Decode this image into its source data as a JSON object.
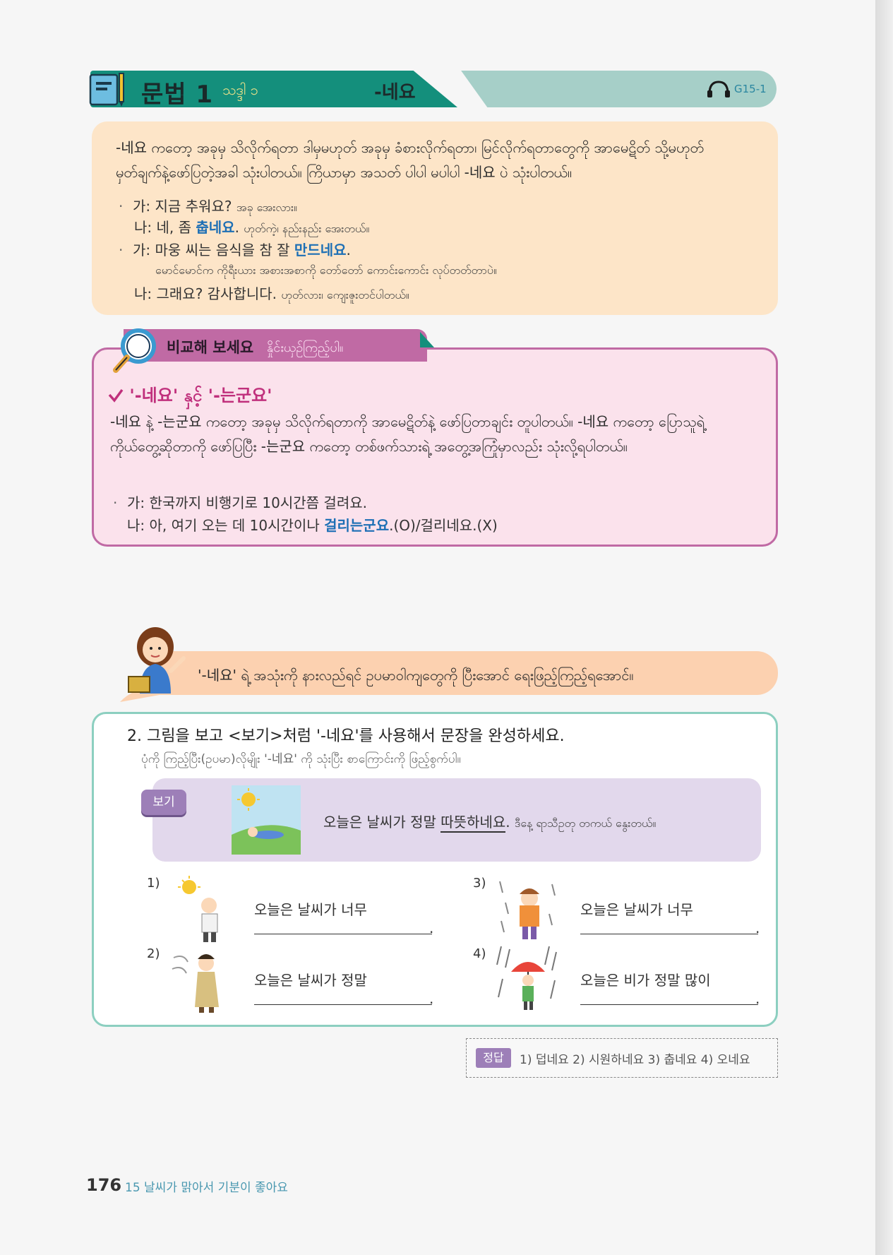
{
  "header": {
    "title": "문법 1",
    "subtitle": "သဒ္ဒါ ၁",
    "pattern": "-네요",
    "audio_code": "G15-1",
    "audio_icon": "headphones-icon",
    "book_icon": "notebook-pencil-icon"
  },
  "explanation": {
    "paragraph": "-네요 ကတော့ အခုမှ သိလိုက်ရတာ ဒါမှမဟုတ် အခုမှ ခံစားလိုက်ရတာ၊ မြင်လိုက်ရတာတွေကို အာမေဋိတ် သို့မဟုတ် မှတ်ချက်နဲ့ဖော်ပြတဲ့အခါ သုံးပါတယ်။ ကြိယာမှာ အသတ် ပါပါ မပါပါ -네요 ပဲ သုံးပါတယ်။",
    "ex1_a_prefix": "가: ",
    "ex1_a": "지금 추워요?",
    "ex1_a_my": "အခု အေးလား။",
    "ex1_b_prefix": "나: 네, 좀 ",
    "ex1_b_hl": "춥네요",
    "ex1_b_end": ".",
    "ex1_b_my": "ဟုတ်ကဲ့၊ နည်းနည်း အေးတယ်။",
    "ex2_a_prefix": "가: 마웅 씨는 음식을 참 잘 ",
    "ex2_a_hl": "만드네요",
    "ex2_a_end": ".",
    "ex2_a_my": "မောင်မောင်က ကိုရီးယား အစားအစာကို တော်တော် ကောင်းကောင်း လုပ်တတ်တာပဲ။",
    "ex2_b": "나: 그래요? 감사합니다.",
    "ex2_b_my": "ဟုတ်လား၊ ကျေးဇူးတင်ပါတယ်။"
  },
  "compare": {
    "tab": "비교해 보세요",
    "tab_my": "နှိုင်းယှဉ်ကြည့်ပါ။",
    "heading": "'-네요' နှင့် '-는군요'",
    "paragraph": "-네요 နဲ့ -는군요 ကတော့ အခုမှ သိလိုက်ရတာကို အာမေဋိတ်နဲ့ ဖော်ပြတာချင်း တူပါတယ်။ -네요 ကတော့ ပြောသူရဲ့ ကိုယ်တွေ့ဆိုတာကို ဖော်ပြပြီး -는군요 ကတော့ တစ်ဖက်သားရဲ့ အတွေ့အကြုံမှာလည်း သုံးလို့ရပါတယ်။",
    "ex_a": "가: 한국까지 비행기로 10시간쯤 걸려요.",
    "ex_b_prefix": "나: 아, 여기 오는 데 10시간이나 ",
    "ex_b_hl": "걸리는군요",
    "ex_b_end": ".(O)/걸리네요.(X)"
  },
  "banner": {
    "text": "'-네요' ရဲ့ အသုံးကို နားလည်ရင် ဥပမာဝါကျတွေကို ပြီးအောင် ရေးဖြည့်ကြည့်ရအောင်။"
  },
  "exercise": {
    "question": "2. 그림을 보고 <보기>처럼 '-네요'를 사용해서 문장을 완성하세요.",
    "question_my": "ပုံကို ကြည့်ပြီး(ဥပမာ)လိုမျိုး '-네요' ကို သုံးပြီး စာကြောင်းကို ဖြည့်စွက်ပါ။",
    "example_label": "보기",
    "example_prefix": "오늘은 날씨가 정말 ",
    "example_underlined": "따뜻하네요",
    "example_end": ".",
    "example_my": "ဒီနေ့ ရာသီဥတု တကယ် နွေးတယ်။",
    "items": [
      {
        "num": "1)",
        "text": "오늘은 날씨가 너무",
        "end": "."
      },
      {
        "num": "2)",
        "text": "오늘은 날씨가 정말",
        "end": "."
      },
      {
        "num": "3)",
        "text": "오늘은 날씨가 너무",
        "end": "."
      },
      {
        "num": "4)",
        "text": "오늘은 비가 정말 많이",
        "end": "."
      }
    ]
  },
  "answer": {
    "label": "정답",
    "text": "1) 덥네요  2) 시원하네요   3) 춥네요  4) 오네요"
  },
  "footer": {
    "page_number": "176",
    "chapter": "15 날씨가 맑아서 기분이 좋아요"
  },
  "colors": {
    "header_dark": "#148f7c",
    "header_light": "#a6cfc8",
    "explain_bg": "#fde5c8",
    "compare_border": "#c06aa4",
    "compare_bg": "#fbe2ec",
    "highlight": "#1d6fb5",
    "exercise_border": "#8ccfc0",
    "example_bg": "#e2d8ec"
  }
}
